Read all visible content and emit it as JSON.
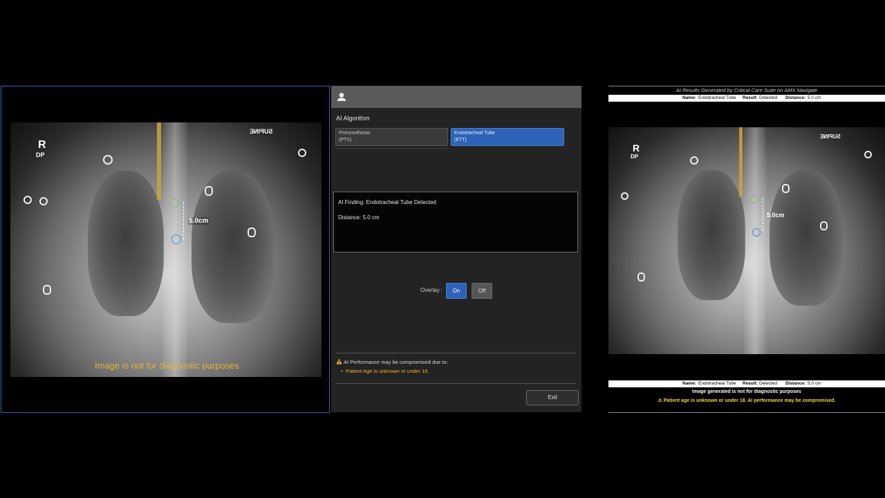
{
  "viewer": {
    "orientation_label": "R",
    "projection_label": "DP",
    "position_label": "SUPINE",
    "measurement": "5.0cm",
    "disclaimer": "Image is not for diagnostic purposes"
  },
  "panel": {
    "section_title": "AI Algorithm",
    "algorithms": [
      {
        "name": "Pneumothorax",
        "abbr": "(PTX)",
        "selected": false
      },
      {
        "name": "Endotracheal Tube",
        "abbr": "(ETT)",
        "selected": true
      }
    ],
    "finding_line": "AI Finding: Endotracheal Tube Detected",
    "distance_line": "Distance: 5.0 cm",
    "overlay_label": "Overlay :",
    "overlay_on": "On",
    "overlay_off": "Off",
    "overlay_state": "On",
    "warning_title": "AI Performance may be compromised due to:",
    "warning_item": "Patient Age is unknown or under 18.",
    "exit_label": "Exit",
    "accent_color": "#2e62b8",
    "warning_color": "#e6b42e"
  },
  "report": {
    "header_title": "AI Results Generated by Critical Care Suite on AMX Navigate",
    "name_label": "Name:",
    "name_value": "Endotracheal Tube",
    "result_label": "Result:",
    "result_value": "Detected",
    "distance_label": "Distance:",
    "distance_value": "5.0 cm",
    "orientation_label": "R",
    "projection_label": "DP",
    "position_label": "SUPINE",
    "measurement": "5.0cm",
    "footer_note": "Image generated is not for diagnostic purposes",
    "footer_warning": "Patient age is unknown or under 18. AI performance may be compromised."
  }
}
